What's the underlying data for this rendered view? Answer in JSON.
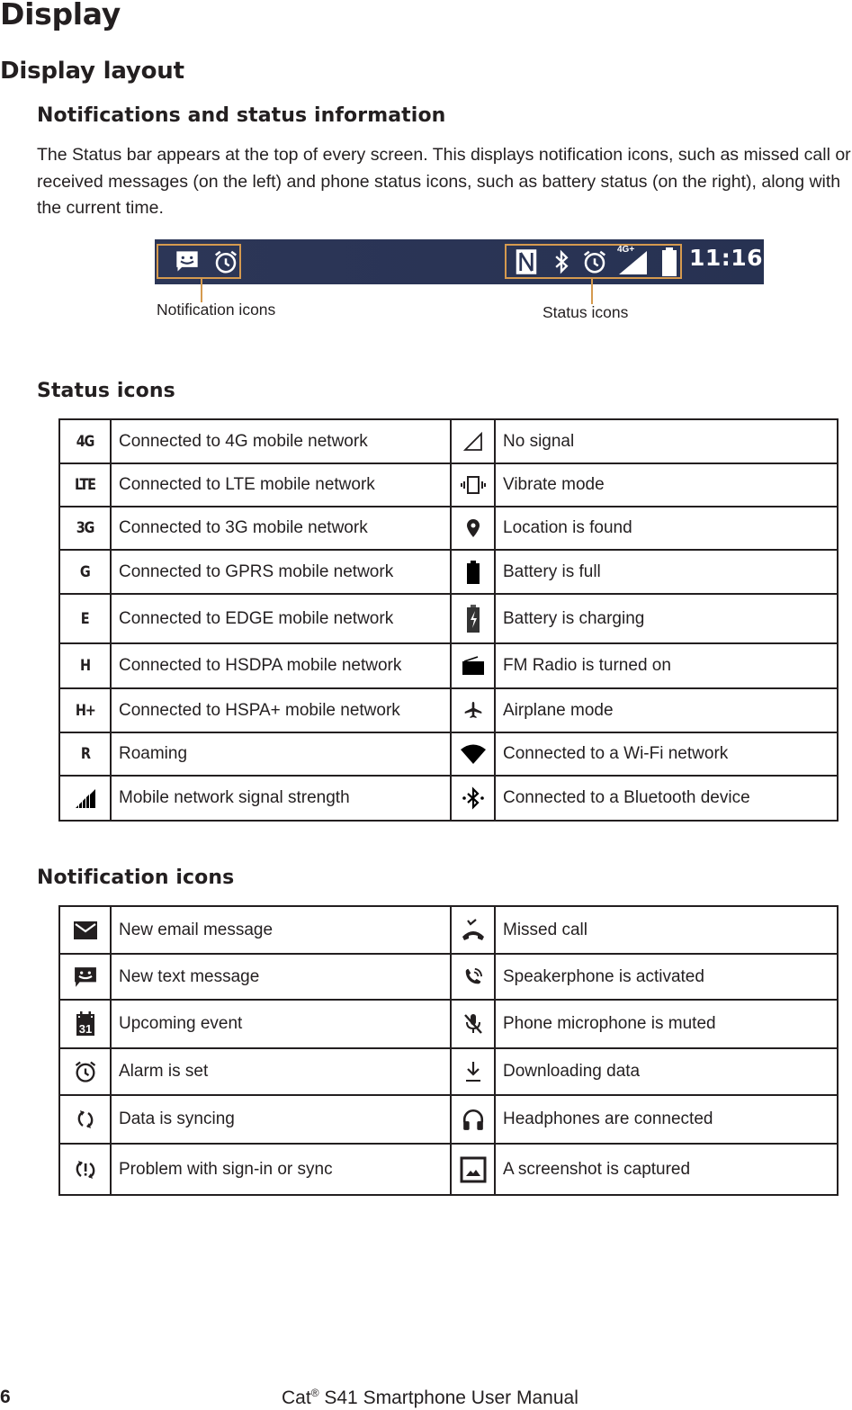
{
  "page": {
    "chapter_title": "Display",
    "section_title": "Display layout",
    "subsection_title": "Notifications and status information",
    "intro_paragraph": "The Status bar appears at the top of every screen. This displays notification icons, such as missed call or received messages (on the left) and phone status icons, such as battery status (on the right), along with the current time."
  },
  "status_bar_illustration": {
    "time": "11:16",
    "network_badge": "4G+",
    "notification_icons": [
      "message-icon",
      "alarm-icon"
    ],
    "status_icons": [
      "nfc-icon",
      "bluetooth-icon",
      "alarm-icon",
      "signal-4g-plus-icon",
      "battery-full-icon"
    ],
    "callout_left": "Notification icons",
    "callout_right": "Status icons",
    "bar_color": "#2a3455",
    "frame_color": "#d59a4f"
  },
  "status_icons_section": {
    "heading": "Status icons",
    "rows": [
      {
        "left_icon": "4G",
        "left_label": "Connected to 4G mobile network",
        "right_icon": "no-signal-icon",
        "right_label": "No signal"
      },
      {
        "left_icon": "LTE",
        "left_label": "Connected to LTE mobile network",
        "right_icon": "vibrate-icon",
        "right_label": "Vibrate mode"
      },
      {
        "left_icon": "3G",
        "left_label": "Connected to 3G mobile network",
        "right_icon": "location-icon",
        "right_label": "Location is found"
      },
      {
        "left_icon": "G",
        "left_label": "Connected to GPRS mobile network",
        "right_icon": "battery-full-icon",
        "right_label": "Battery is full"
      },
      {
        "left_icon": "E",
        "left_label": "Connected to EDGE mobile network",
        "right_icon": "battery-charging-icon",
        "right_label": "Battery is charging"
      },
      {
        "left_icon": "H",
        "left_label": "Connected to HSDPA mobile network",
        "right_icon": "radio-icon",
        "right_label": "FM Radio is turned on"
      },
      {
        "left_icon": "H+",
        "left_label": "Connected to HSPA+ mobile network",
        "right_icon": "airplane-icon",
        "right_label": "Airplane mode"
      },
      {
        "left_icon": "R",
        "left_label": "Roaming",
        "right_icon": "wifi-icon",
        "right_label": "Connected to a Wi-Fi network"
      },
      {
        "left_icon": "signal-strength-icon",
        "left_label": "Mobile network signal strength",
        "right_icon": "bluetooth-connected-icon",
        "right_label": "Connected to a Bluetooth device"
      }
    ]
  },
  "notification_icons_section": {
    "heading": "Notification icons",
    "rows": [
      {
        "left_icon": "email-icon",
        "left_label": "New email message",
        "right_icon": "missed-call-icon",
        "right_label": "Missed call"
      },
      {
        "left_icon": "text-message-icon",
        "left_label": "New text message",
        "right_icon": "speakerphone-icon",
        "right_label": "Speakerphone is activated"
      },
      {
        "left_icon": "calendar-icon",
        "left_label": "Upcoming event",
        "right_icon": "mic-muted-icon",
        "right_label": "Phone microphone is muted"
      },
      {
        "left_icon": "alarm-icon",
        "left_label": "Alarm is set",
        "right_icon": "download-icon",
        "right_label": "Downloading data"
      },
      {
        "left_icon": "sync-icon",
        "left_label": "Data is syncing",
        "right_icon": "headphones-icon",
        "right_label": "Headphones are connected"
      },
      {
        "left_icon": "sync-problem-icon",
        "left_label": "Problem with sign-in or sync",
        "right_icon": "screenshot-icon",
        "right_label": "A screenshot is captured"
      }
    ],
    "calendar_day": "31"
  },
  "footer": {
    "page_number": "6",
    "brand": "Cat",
    "registered_mark": "®",
    "manual_title": "S41 Smartphone User Manual"
  }
}
